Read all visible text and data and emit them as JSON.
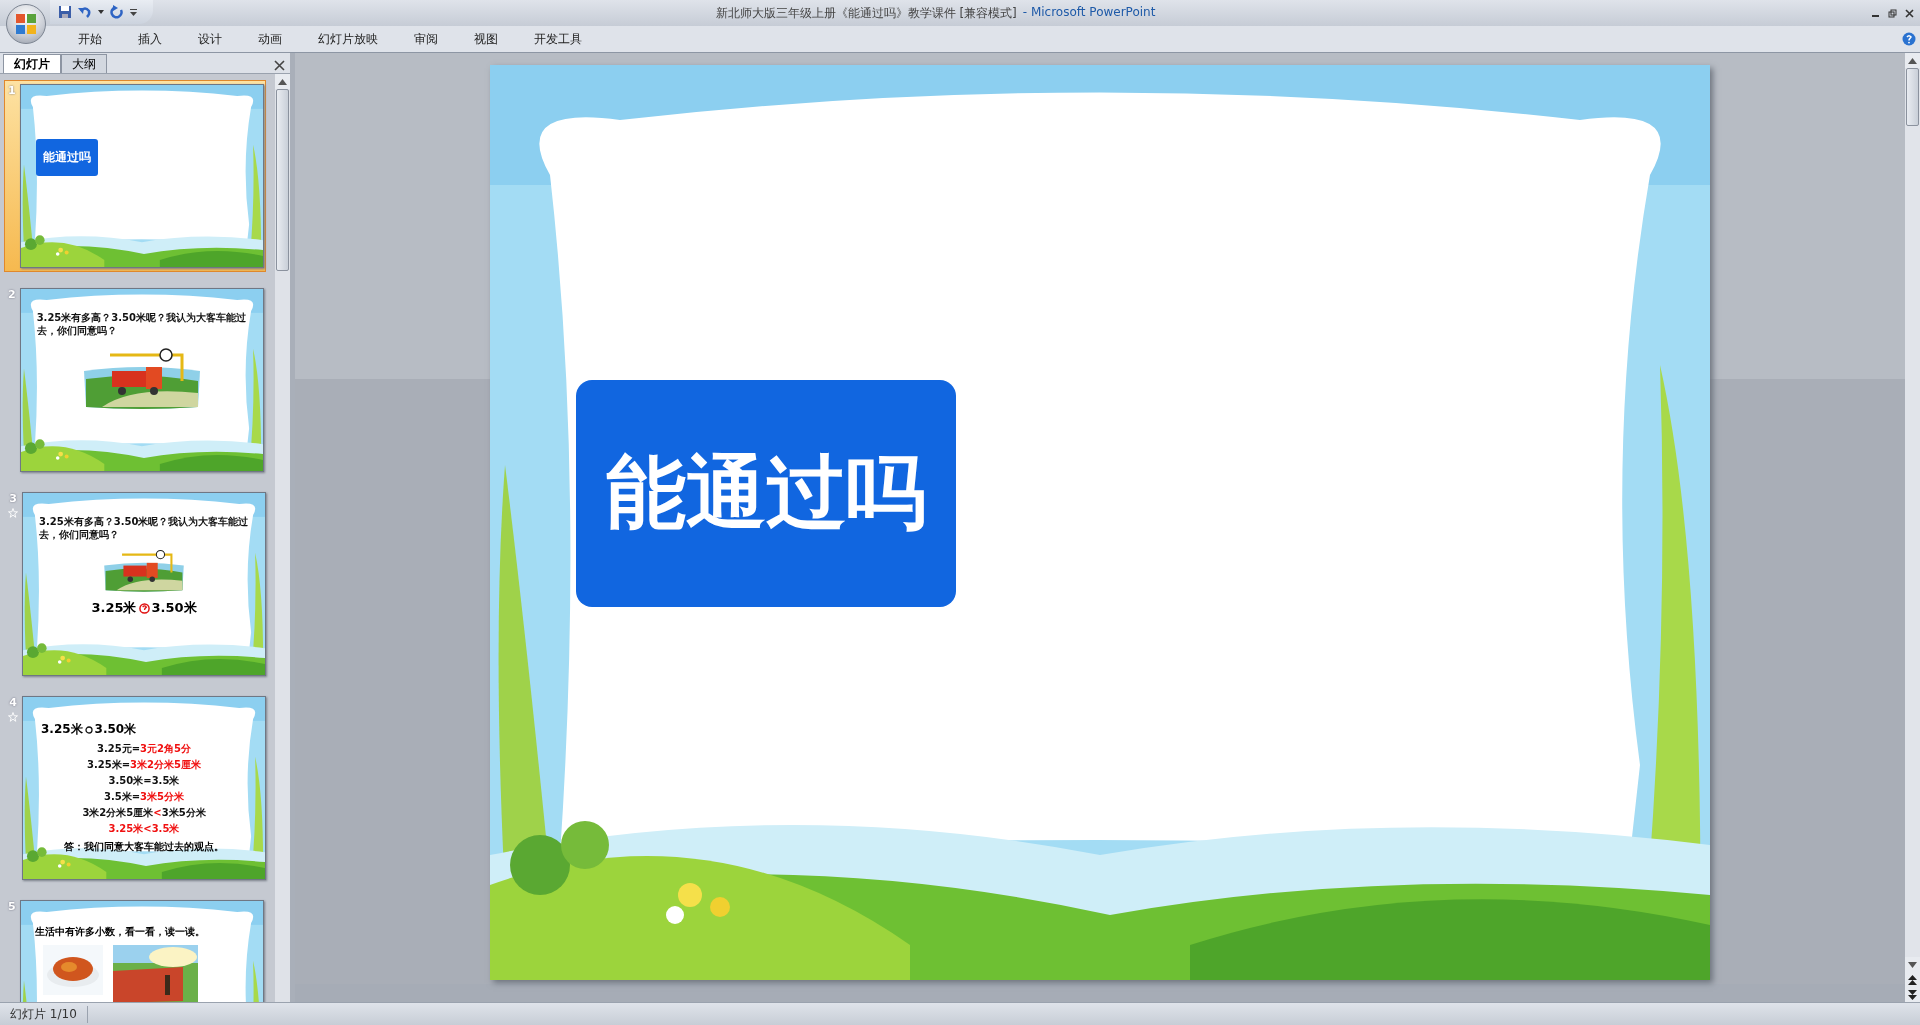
{
  "window": {
    "title": "新北师大版三年级上册《能通过吗》教学课件 [兼容模式]",
    "app_name": "- Microsoft PowerPoint"
  },
  "ribbon_tabs": [
    "开始",
    "插入",
    "设计",
    "动画",
    "幻灯片放映",
    "审阅",
    "视图",
    "开发工具"
  ],
  "panel_tabs": [
    {
      "label": "幻灯片",
      "selected": true
    },
    {
      "label": "大纲",
      "selected": false
    }
  ],
  "thumbnails": [
    {
      "number": "1",
      "selected": true,
      "animated": false,
      "kind": "title",
      "title": "能通过吗"
    },
    {
      "number": "2",
      "selected": false,
      "animated": false,
      "kind": "question",
      "question": "3.25米有多高？3.50米呢？我认为大客车能过去，你们同意吗？"
    },
    {
      "number": "3",
      "selected": false,
      "animated": true,
      "kind": "question_compare",
      "question": "3.25米有多高？3.50米呢？我认为大客车能过去，你们同意吗？",
      "left": "3.25米",
      "right": "3.50米"
    },
    {
      "number": "4",
      "selected": false,
      "animated": true,
      "kind": "comparison",
      "left": "3.25米",
      "right": "3.50米",
      "lines": [
        {
          "segments": [
            {
              "text": "3.25元=",
              "highlight": false
            },
            {
              "text": "3元2角5分",
              "highlight": true
            }
          ]
        },
        {
          "segments": [
            {
              "text": "3.25米=",
              "highlight": false
            },
            {
              "text": "3米2分米5厘米",
              "highlight": true
            }
          ]
        },
        {
          "segments": [
            {
              "text": "3.50米=3.5米",
              "highlight": false
            }
          ]
        },
        {
          "segments": [
            {
              "text": "3.5米=",
              "highlight": false
            },
            {
              "text": "3米5分米",
              "highlight": true
            }
          ]
        },
        {
          "segments": [
            {
              "text": "3米2分米5厘米",
              "highlight": false
            },
            {
              "text": "<",
              "highlight": true
            },
            {
              "text": "3米5分米",
              "highlight": false
            }
          ]
        },
        {
          "segments": [
            {
              "text": "3.25米<3.5米",
              "highlight": true
            }
          ]
        }
      ],
      "answer": "答：我们同意大客车能过去的观点。"
    },
    {
      "number": "5",
      "selected": false,
      "animated": false,
      "kind": "reading",
      "heading": "生活中有许多小数，看一看，读一读。"
    }
  ],
  "slide": {
    "title": "能通过吗"
  },
  "status_bar": {
    "slide_position": "幻灯片 1/10"
  }
}
